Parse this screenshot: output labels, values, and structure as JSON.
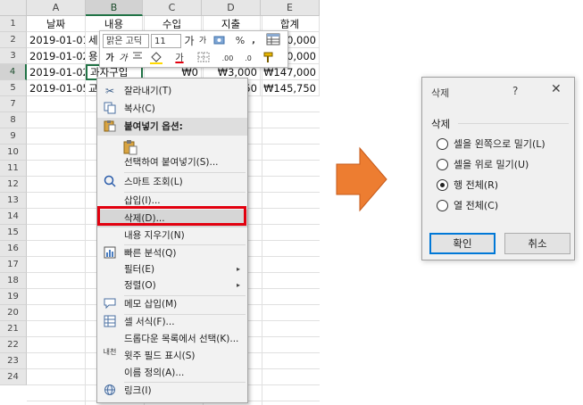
{
  "sheet": {
    "columns": [
      "A",
      "B",
      "C",
      "D",
      "E"
    ],
    "rows": [
      "1",
      "2",
      "3",
      "4",
      "5",
      "7",
      "8",
      "9",
      "10",
      "11",
      "12",
      "13",
      "14",
      "15",
      "16",
      "17",
      "18",
      "19",
      "20",
      "21",
      "22",
      "23",
      "24"
    ],
    "header_cells": {
      "a": "날짜",
      "b": "내용",
      "c": "수입",
      "d": "지출",
      "e": "합계"
    },
    "data": [
      {
        "a": "2019-01-01",
        "b": "세",
        "e": "₩60,000"
      },
      {
        "a": "2019-01-02",
        "b": "용",
        "e": "₩60,000"
      },
      {
        "a": "2019-01-02",
        "b": "과자구입",
        "c": "₩0",
        "d": "₩3,000",
        "e": "₩147,000"
      },
      {
        "a": "2019-01-05",
        "b": "교",
        "d": "50",
        "e": "₩145,750"
      }
    ]
  },
  "mini_toolbar": {
    "font_name": "맑은 고딕",
    "font_size": "11",
    "grow_font": "가",
    "shrink_font": "가",
    "percent": "%",
    "comma": ",",
    "bold": "가",
    "italic": "가",
    "font_color_letter": "가",
    "dec_increase": ".00",
    "dec_decrease": ".0"
  },
  "context_menu": {
    "items": [
      {
        "label": "잘라내기(T)",
        "icon": "scissors-icon"
      },
      {
        "label": "복사(C)",
        "icon": "copy-icon"
      },
      {
        "label": "붙여넣기 옵션:",
        "icon": "paste-icon"
      },
      {
        "label": "선택하여 붙여넣기(S)..."
      },
      {
        "label": "스마트 조회(L)",
        "icon": "smart-lookup-icon"
      },
      {
        "label": "삽입(I)..."
      },
      {
        "label": "삭제(D)..."
      },
      {
        "label": "내용 지우기(N)"
      },
      {
        "label": "빠른 분석(Q)",
        "icon": "quick-analysis-icon"
      },
      {
        "label": "필터(E)"
      },
      {
        "label": "정렬(O)"
      },
      {
        "label": "메모 삽입(M)",
        "icon": "comment-icon"
      },
      {
        "label": "셀 서식(F)...",
        "icon": "format-cells-icon"
      },
      {
        "label": "드롭다운 목록에서 선택(K)..."
      },
      {
        "label": "윗주 필드 표시(S)",
        "icon": "phonetic-icon"
      },
      {
        "label": "이름 정의(A)..."
      },
      {
        "label": "링크(I)",
        "icon": "link-icon"
      }
    ],
    "submenu_arrow": "▸",
    "phonetic_glyph": "내천"
  },
  "dialog": {
    "title": "삭제",
    "help": "?",
    "close": "✕",
    "group_label": "삭제",
    "options": [
      {
        "label": "셀을 왼쪽으로 밀기(L)",
        "checked": false
      },
      {
        "label": "셀을 위로 밀기(U)",
        "checked": false
      },
      {
        "label": "행 전체(R)",
        "checked": true
      },
      {
        "label": "열 전체(C)",
        "checked": false
      }
    ],
    "ok": "확인",
    "cancel": "취소"
  },
  "colors": {
    "excel_green": "#217346",
    "highlight_red": "#e2000f",
    "arrow_orange": "#ed7d31",
    "dialog_accent": "#0078d7"
  }
}
